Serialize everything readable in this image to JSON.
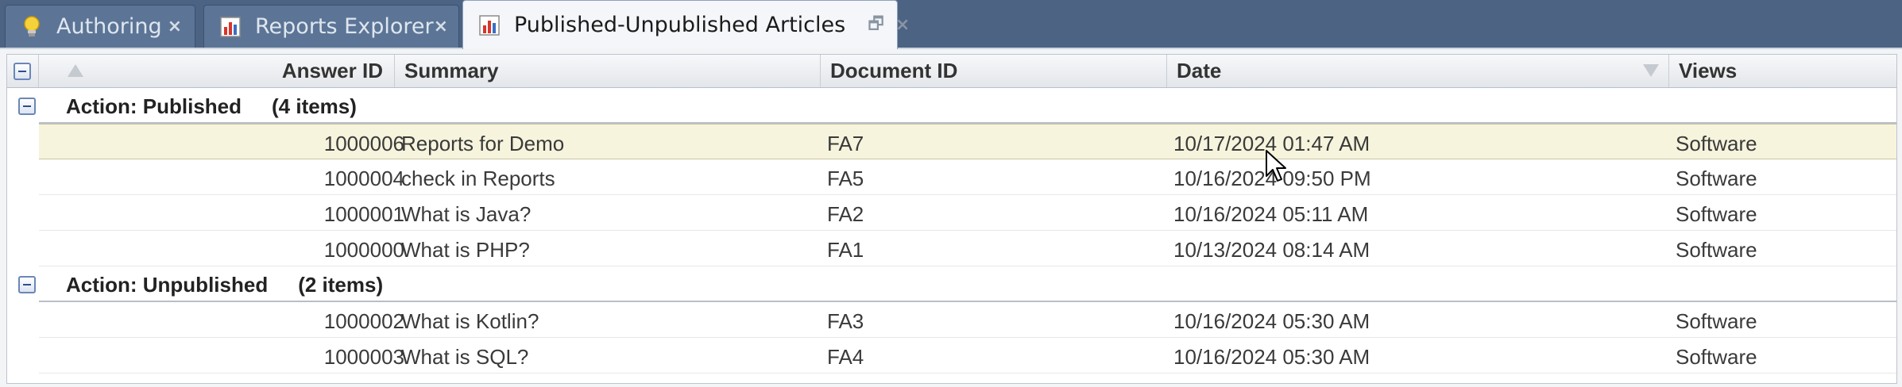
{
  "tabs": [
    {
      "label": "Authoring",
      "icon": "lightbulb-icon",
      "close": "×",
      "active": false
    },
    {
      "label": "Reports Explorer",
      "icon": "report-chart-icon",
      "close": "×",
      "active": false
    },
    {
      "label": "Published-Unpublished Articles",
      "icon": "report-chart-icon",
      "close": "×",
      "restore": "🗗",
      "active": true
    }
  ],
  "columns": {
    "answer_id": "Answer ID",
    "summary": "Summary",
    "document_id": "Document ID",
    "date": "Date",
    "views": "Views"
  },
  "groups": [
    {
      "label": "Action: Published",
      "count": "(4 items)",
      "rows": [
        {
          "answer_id": "1000006",
          "summary": "Reports for Demo",
          "document_id": "FA7",
          "date": "10/17/2024 01:47 AM",
          "views": "Software",
          "selected": true
        },
        {
          "answer_id": "1000004",
          "summary": "check in Reports",
          "document_id": "FA5",
          "date": "10/16/2024 09:50 PM",
          "views": "Software"
        },
        {
          "answer_id": "1000001",
          "summary": "What is Java?",
          "document_id": "FA2",
          "date": "10/16/2024 05:11 AM",
          "views": "Software"
        },
        {
          "answer_id": "1000000",
          "summary": "What is PHP?",
          "document_id": "FA1",
          "date": "10/13/2024 08:14 AM",
          "views": "Software"
        }
      ]
    },
    {
      "label": "Action: Unpublished",
      "count": "(2 items)",
      "rows": [
        {
          "answer_id": "1000002",
          "summary": "What is Kotlin?",
          "document_id": "FA3",
          "date": "10/16/2024 05:30 AM",
          "views": "Software"
        },
        {
          "answer_id": "1000003",
          "summary": "What is SQL?",
          "document_id": "FA4",
          "date": "10/16/2024 05:30 AM",
          "views": "Software"
        }
      ]
    }
  ],
  "colors": {
    "tabstrip_bg": "#4c6383",
    "inactive_tab": "#5c7596",
    "active_tab": "#f4f6f9",
    "selected_row": "#f6f4dc"
  }
}
